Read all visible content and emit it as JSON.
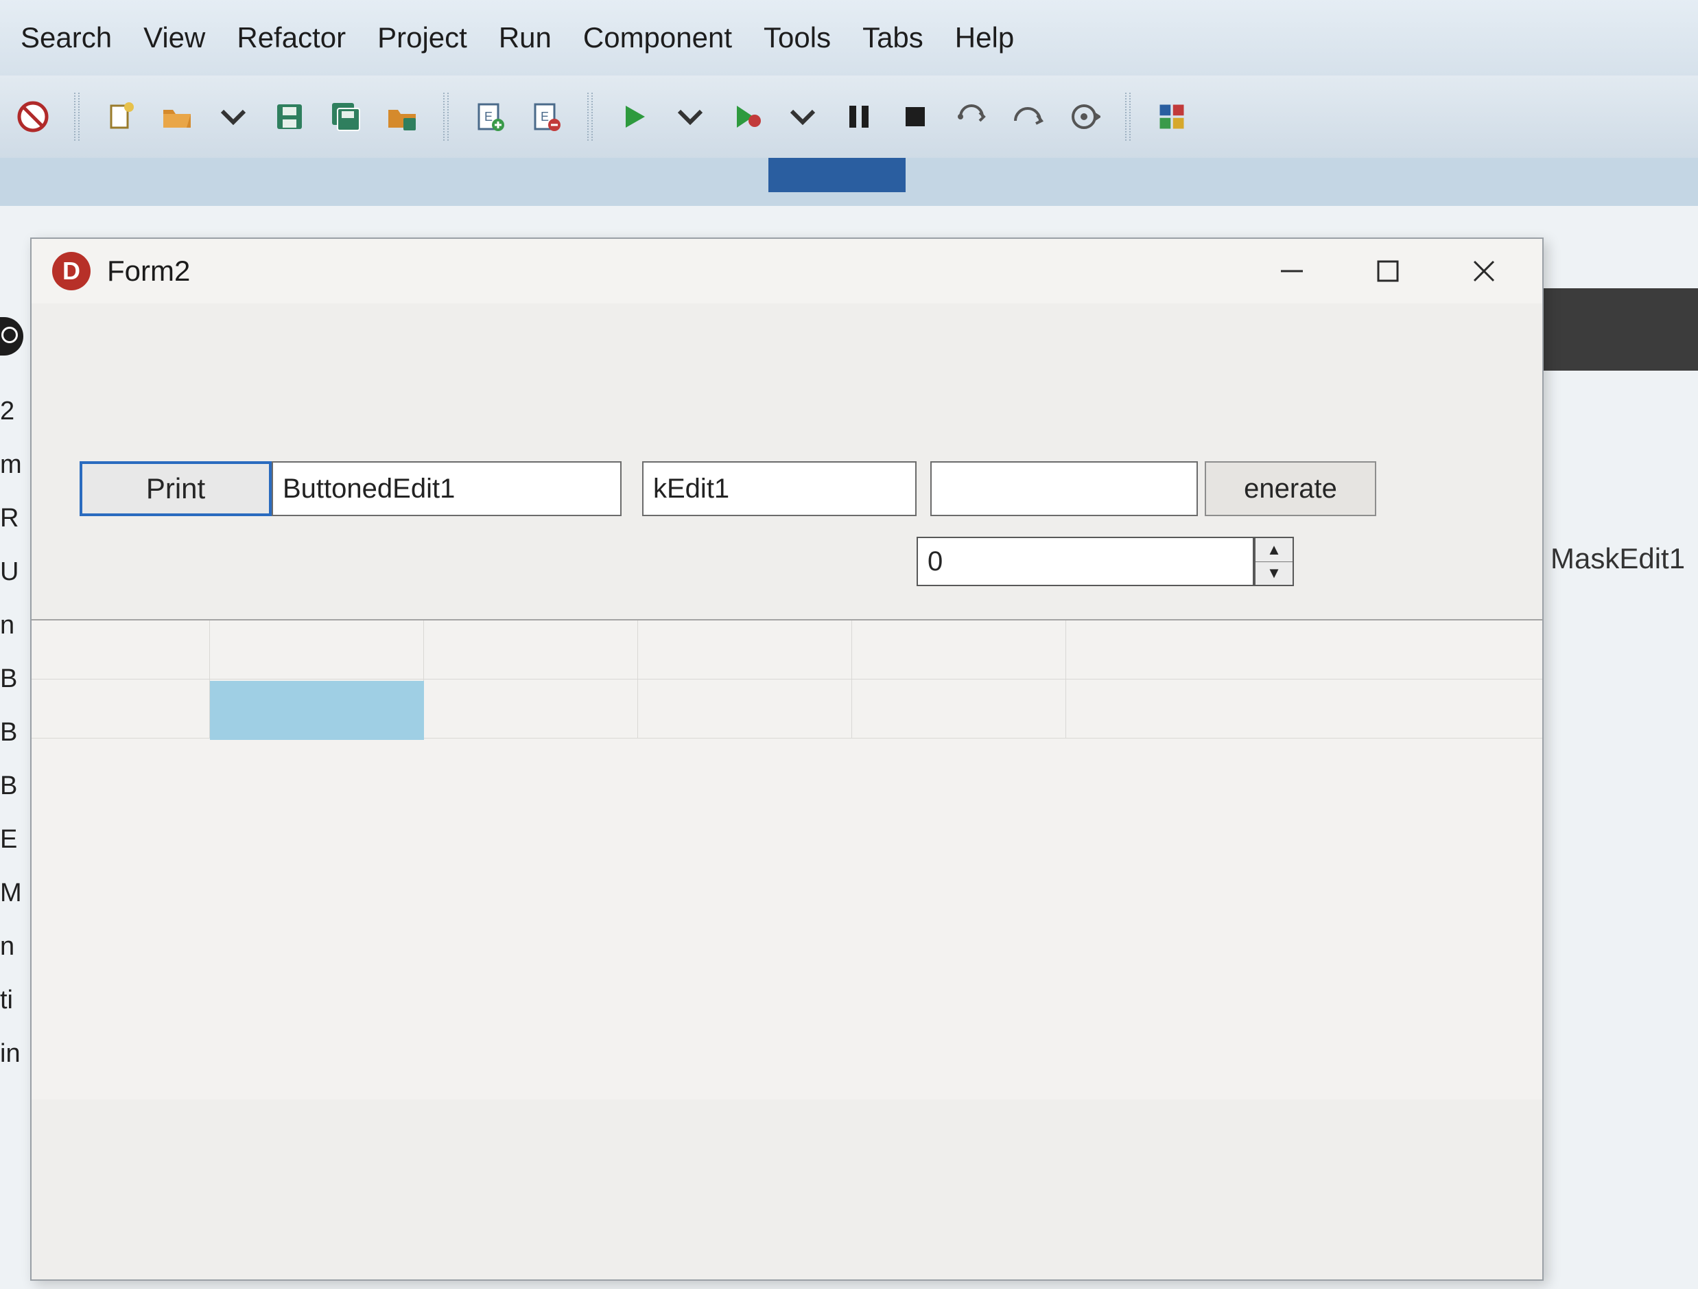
{
  "menu": [
    "Search",
    "View",
    "Refactor",
    "Project",
    "Run",
    "Component",
    "Tools",
    "Tabs",
    "Help"
  ],
  "form": {
    "title": "Form2",
    "print_button": "Print",
    "buttoned_edit_value": "ButtonedEdit1",
    "mask_edit_value": "kEdit1",
    "generate_button": "enerate",
    "spin_edit_value": "0"
  },
  "background": {
    "mask_edit_label": "MaskEdit1",
    "left_list": [
      "2",
      "m",
      "R",
      "U",
      "n",
      "B",
      "B",
      "B",
      "E",
      "M",
      "n",
      "ti",
      "in"
    ]
  }
}
